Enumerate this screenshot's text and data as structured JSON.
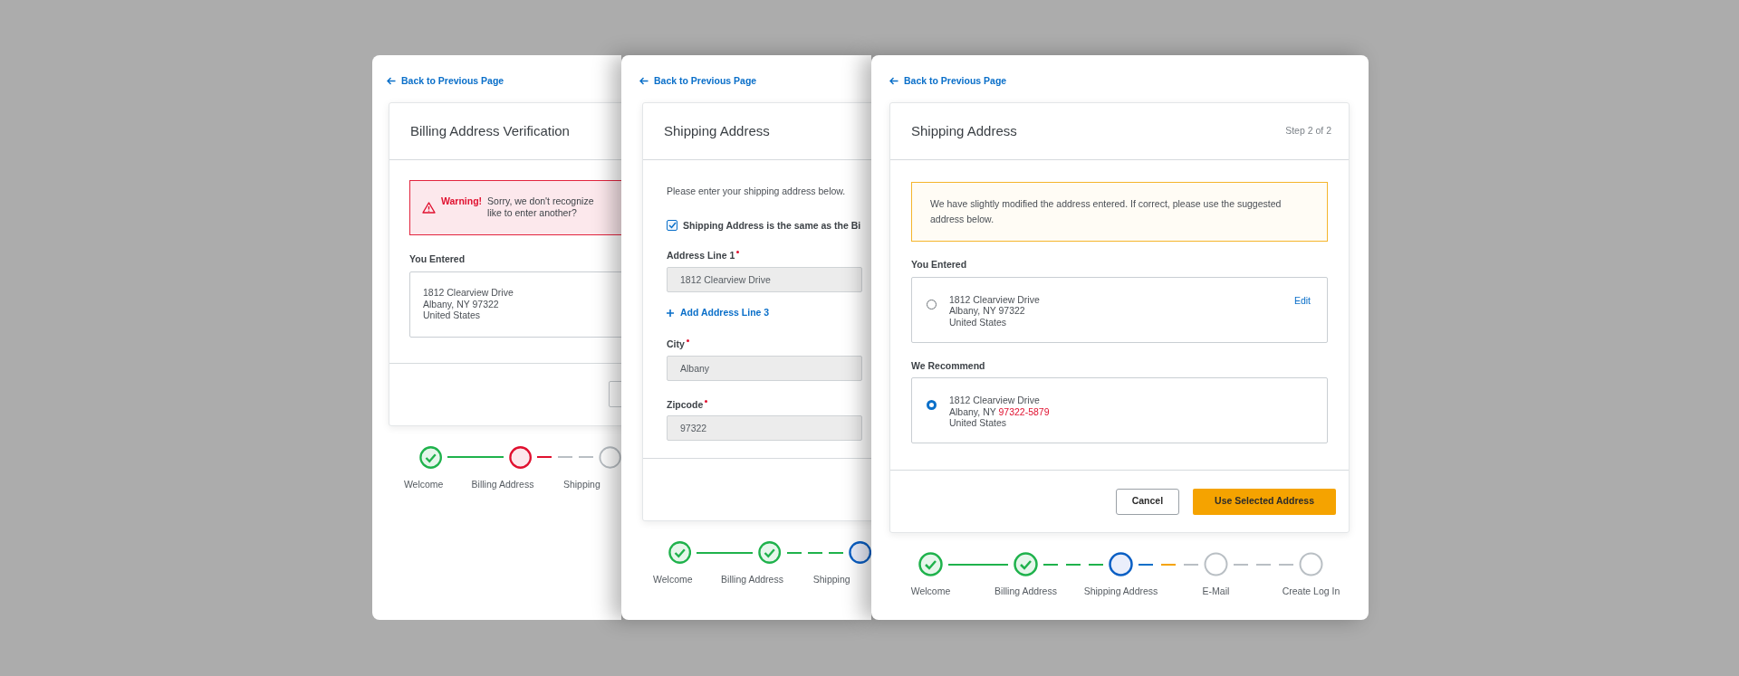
{
  "screens": [
    {
      "kind": "billing_warning",
      "back_link": "Back to Previous Page",
      "title": "Billing Address Verification",
      "warning": {
        "label": "Warning!",
        "message_lines": [
          "Sorry, we don't recognize",
          "like to enter another?"
        ]
      },
      "entered_label": "You Entered",
      "entered_address": [
        "1812 Clearview Drive",
        "Albany, NY 97322",
        "United States"
      ],
      "steps": [
        {
          "label": "Welcome",
          "kind": "complete"
        },
        {
          "label": "Billing Address",
          "kind": "error"
        },
        {
          "label": "Shipping",
          "kind": "pending"
        }
      ],
      "connectors": [
        {
          "kind": "solid",
          "color": "#1fb24c"
        },
        {
          "kind": "dashed",
          "segments": [
            {
              "color": "#e0102f"
            },
            {
              "color": "#b9bfc4"
            },
            {
              "color": "#b9bfc4"
            }
          ]
        }
      ]
    },
    {
      "kind": "shipping_form",
      "back_link": "Back to Previous Page",
      "title": "Shipping Address",
      "intro": "Please enter your shipping address below.",
      "same_as_billing": {
        "label": "Shipping Address is the same as the Bi",
        "checked": true
      },
      "fields": [
        {
          "kind": "input",
          "label": "Address Line 1",
          "required": true,
          "value": "1812 Clearview Drive"
        },
        {
          "kind": "link",
          "label": "Add Address Line 3"
        },
        {
          "kind": "input",
          "label": "City",
          "required": true,
          "value": "Albany"
        },
        {
          "kind": "input",
          "label": "Zipcode",
          "required": true,
          "value": "97322"
        }
      ],
      "steps": [
        {
          "label": "Welcome",
          "kind": "complete"
        },
        {
          "label": "Billing Address",
          "kind": "complete"
        },
        {
          "label": "Shipping",
          "kind": "current"
        }
      ],
      "connectors": [
        {
          "kind": "solid",
          "color": "#1fb24c"
        },
        {
          "kind": "dashed",
          "segments": [
            {
              "color": "#1fb24c"
            },
            {
              "color": "#1fb24c"
            },
            {
              "color": "#1fb24c"
            }
          ]
        }
      ]
    },
    {
      "kind": "shipping_verify",
      "back_link": "Back to Previous Page",
      "title": "Shipping Address",
      "step_text": "Step 2 of 2",
      "notice": "We have slightly modified the address entered. If correct, please use the suggested address below.",
      "options": [
        {
          "heading": "You Entered",
          "selected": false,
          "edit": "Edit",
          "lines": [
            [
              {
                "text": "1812 Clearview Drive",
                "changed": false
              }
            ],
            [
              {
                "text": "Albany, NY 97322",
                "changed": false
              }
            ],
            [
              {
                "text": "United States",
                "changed": false
              }
            ]
          ]
        },
        {
          "heading": "We Recommend",
          "selected": true,
          "lines": [
            [
              {
                "text": "1812 Clearview Drive",
                "changed": false
              }
            ],
            [
              {
                "text": "Albany, NY",
                "changed": false
              },
              {
                "text": "97322-5879",
                "changed": true
              }
            ],
            [
              {
                "text": "United States",
                "changed": false
              }
            ]
          ]
        }
      ],
      "buttons": [
        {
          "label": "Cancel",
          "kind": "secondary"
        },
        {
          "label": "Use Selected Address",
          "kind": "primary"
        }
      ],
      "steps": [
        {
          "label": "Welcome",
          "kind": "complete"
        },
        {
          "label": "Billing Address",
          "kind": "complete"
        },
        {
          "label": "Shipping Address",
          "kind": "current"
        },
        {
          "label": "E-Mail",
          "kind": "pending"
        },
        {
          "label": "Create Log In",
          "kind": "pending"
        }
      ],
      "connectors": [
        {
          "kind": "solid",
          "color": "#1fb24c"
        },
        {
          "kind": "dashed",
          "segments": [
            {
              "color": "#1fb24c"
            },
            {
              "color": "#1fb24c"
            },
            {
              "color": "#1fb24c"
            }
          ]
        },
        {
          "kind": "dashed",
          "segments": [
            {
              "color": "#0a6fc9"
            },
            {
              "color": "#f5a300"
            },
            {
              "color": "#b9bfc4"
            }
          ]
        },
        {
          "kind": "dashed",
          "segments": [
            {
              "color": "#b9bfc4"
            },
            {
              "color": "#b9bfc4"
            },
            {
              "color": "#b9bfc4"
            }
          ]
        }
      ]
    }
  ]
}
